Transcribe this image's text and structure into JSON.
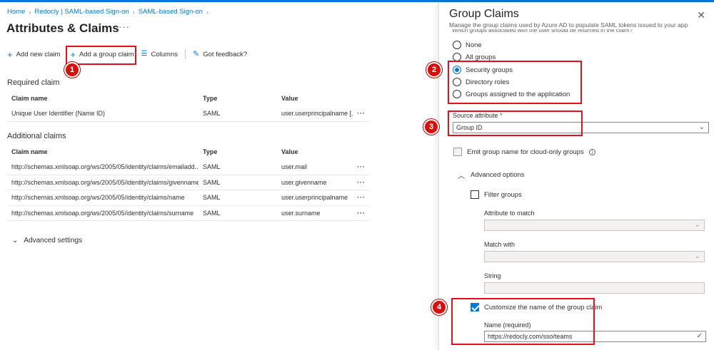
{
  "breadcrumb": [
    "Home",
    "Redocly | SAML-based Sign-on",
    "SAML-based Sign-on"
  ],
  "page": {
    "title": "Attributes & Claims",
    "more": "···"
  },
  "toolbar": {
    "add_new_claim": "Add new claim",
    "add_group_claim": "Add a group claim",
    "columns": "Columns",
    "feedback": "Got feedback?"
  },
  "required_claim": {
    "heading": "Required claim",
    "columns": [
      "Claim name",
      "Type",
      "Value"
    ],
    "rows": [
      {
        "name": "Unique User Identifier (Name ID)",
        "type": "SAML",
        "value": "user.userprincipalname [...",
        "more": "···"
      }
    ]
  },
  "additional_claims": {
    "heading": "Additional claims",
    "columns": [
      "Claim name",
      "Type",
      "Value"
    ],
    "rows": [
      {
        "name": "http://schemas.xmlsoap.org/ws/2005/05/identity/claims/emailadd...",
        "type": "SAML",
        "value": "user.mail",
        "more": "···"
      },
      {
        "name": "http://schemas.xmlsoap.org/ws/2005/05/identity/claims/givenname",
        "type": "SAML",
        "value": "user.givenname",
        "more": "···"
      },
      {
        "name": "http://schemas.xmlsoap.org/ws/2005/05/identity/claims/name",
        "type": "SAML",
        "value": "user.userprincipalname",
        "more": "···"
      },
      {
        "name": "http://schemas.xmlsoap.org/ws/2005/05/identity/claims/surname",
        "type": "SAML",
        "value": "user.surname",
        "more": "···"
      }
    ]
  },
  "advanced_settings": "Advanced settings",
  "panel": {
    "title": "Group Claims",
    "subtitle": "Manage the group claims used by Azure AD to populate SAML tokens issued to your app",
    "cut_text": "Which groups associated with the user should be returned in the claim?",
    "radios": [
      "None",
      "All groups",
      "Security groups",
      "Directory roles",
      "Groups assigned to the application"
    ],
    "selected_radio": "Security groups",
    "source_attribute": {
      "label": "Source attribute",
      "required_mark": "*",
      "value": "Group ID"
    },
    "emit_cloud_only": "Emit group name for cloud-only groups",
    "advanced_options": "Advanced options",
    "filter_groups": "Filter groups",
    "attribute_to_match": "Attribute to match",
    "match_with": "Match with",
    "string": "String",
    "customize_name": "Customize the name of the group claim",
    "name_label": "Name (required)",
    "name_value": "https://redocly.com/sso/teams"
  },
  "annotations": [
    "1",
    "2",
    "3",
    "4"
  ],
  "colors": {
    "accent": "#0078d4",
    "annotation_red": "#e3101f"
  }
}
